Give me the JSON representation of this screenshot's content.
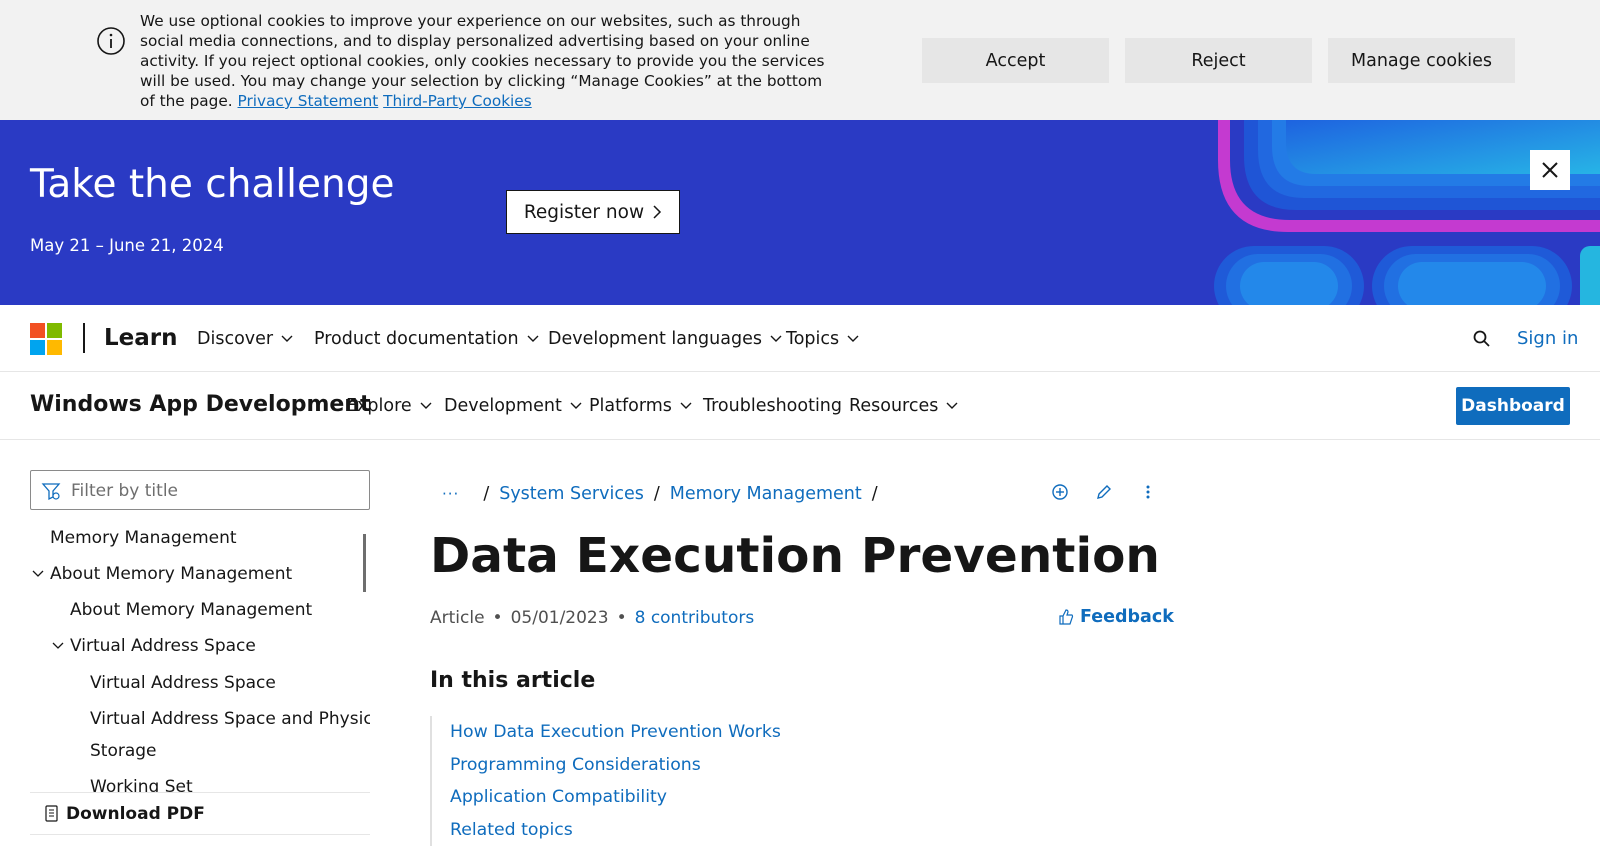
{
  "cookie_banner": {
    "message": "We use optional cookies to improve your experience on our websites, such as through social media connections, and to display personalized advertising based on your online activity. If you reject optional cookies, only cookies necessary to provide you the services will be used. You may change your selection by clicking “Manage Cookies” at the bottom of the page.",
    "privacy_link": "Privacy Statement",
    "third_party_link": "Third-Party Cookies",
    "accept_label": "Accept",
    "reject_label": "Reject",
    "manage_label": "Manage cookies"
  },
  "promo": {
    "title": "Take the challenge",
    "dates": "May 21 – June 21, 2024",
    "register_label": "Register now",
    "background_color": "#2a3ac4"
  },
  "global_nav": {
    "brand": "Learn",
    "items": [
      {
        "label": "Discover"
      },
      {
        "label": "Product documentation"
      },
      {
        "label": "Development languages"
      },
      {
        "label": "Topics"
      }
    ],
    "sign_in": "Sign in"
  },
  "product_nav": {
    "title": "Windows App Development",
    "items": [
      {
        "label": "Explore"
      },
      {
        "label": "Development"
      },
      {
        "label": "Platforms"
      },
      {
        "label": "Troubleshooting"
      },
      {
        "label": "Resources"
      }
    ],
    "dashboard_label": "Dashboard"
  },
  "sidebar": {
    "filter_placeholder": "Filter by title",
    "toc": [
      {
        "label": "Memory Management"
      },
      {
        "label": "About Memory Management"
      },
      {
        "label": "About Memory Management"
      },
      {
        "label": "Virtual Address Space"
      },
      {
        "label": "Virtual Address Space"
      },
      {
        "label": "Virtual Address Space and Physical"
      },
      {
        "label": "Storage"
      },
      {
        "label": "Working Set"
      }
    ],
    "download_pdf": "Download PDF"
  },
  "breadcrumb": {
    "more": "···",
    "items": [
      {
        "label": "System Services"
      },
      {
        "label": "Memory Management"
      }
    ]
  },
  "article": {
    "title": "Data Execution Prevention",
    "type": "Article",
    "date": "05/01/2023",
    "contributors": "8 contributors",
    "feedback": "Feedback",
    "in_this_article": "In this article",
    "sections": [
      {
        "label": "How Data Execution Prevention Works"
      },
      {
        "label": "Programming Considerations"
      },
      {
        "label": "Application Compatibility"
      },
      {
        "label": "Related topics"
      }
    ]
  },
  "colors": {
    "accent": "#0f6cbd",
    "text": "#161616"
  }
}
